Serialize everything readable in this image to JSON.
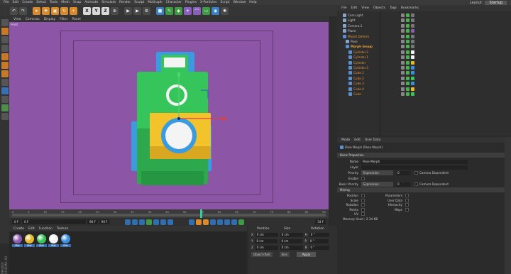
{
  "menu": [
    "File",
    "Edit",
    "Create",
    "Select",
    "Tools",
    "Mesh",
    "Snap",
    "Animate",
    "Simulate",
    "Render",
    "Sculpt",
    "MoGraph",
    "Character",
    "Plugins",
    "X-Particles",
    "Script",
    "Window",
    "Help"
  ],
  "layout": {
    "label": "Layout:",
    "value": "Startup"
  },
  "toolbar": {
    "x": "X",
    "y": "Y",
    "z": "Z"
  },
  "viewport": {
    "menu": [
      "View",
      "Cameras",
      "Display",
      "Filter",
      "Panel"
    ],
    "label": "Front"
  },
  "timeline": {
    "ticks": [
      "0",
      "5",
      "10",
      "15",
      "20",
      "25",
      "30",
      "35",
      "40",
      "45",
      "50",
      "55",
      "60",
      "65",
      "70",
      "75",
      "80",
      "85",
      "90"
    ],
    "frame_start": "0 F",
    "frame_current": "0 F",
    "frame_end": "90 F",
    "frame_total": "90 F",
    "frame_right": "54 F",
    "cursor_frame": 54
  },
  "materials": {
    "menu": [
      "Create",
      "Edit",
      "Function",
      "Texture"
    ],
    "items": [
      {
        "label": "Mat",
        "color": "#8e5bb0"
      },
      {
        "label": "Mat",
        "color": "#e7b92b"
      },
      {
        "label": "Mat",
        "color": "#3cc35a"
      },
      {
        "label": "Mat",
        "color": "#f2f2f2"
      },
      {
        "label": "Mat",
        "color": "#3b8fe0"
      }
    ],
    "watermark": "MAXON CINEMA 4D"
  },
  "coordinates": {
    "headers": [
      "Position",
      "Size",
      "Rotation"
    ],
    "rows": [
      {
        "axis": "X",
        "pos": "0 cm",
        "size": "0 cm",
        "rot_label": "H",
        "rot": "0 °"
      },
      {
        "axis": "Y",
        "pos": "0 cm",
        "size": "0 cm",
        "rot_label": "P",
        "rot": "0 °"
      },
      {
        "axis": "Z",
        "pos": "0 cm",
        "size": "0 cm",
        "rot_label": "B",
        "rot": "0 °"
      }
    ],
    "mode": "Object (Rel)",
    "size_mode": "Size",
    "apply": "Apply"
  },
  "objects": {
    "menu": [
      "File",
      "Edit",
      "View",
      "Objects",
      "Tags",
      "Bookmarks"
    ],
    "items": [
      {
        "name": "Cam Light",
        "style": "normal",
        "tag": "#777"
      },
      {
        "name": "Light",
        "style": "normal",
        "tag": "#777"
      },
      {
        "name": "Camera.1",
        "style": "normal",
        "tag": "#777"
      },
      {
        "name": "Plane",
        "style": "normal",
        "tag": "#8e5bb0"
      },
      {
        "name": "Morph Deform",
        "style": "orange",
        "tag": "#777"
      },
      {
        "name": "Pose",
        "style": "normal",
        "tag": "#777"
      },
      {
        "name": "Morph Group",
        "style": "highlight",
        "tag": "#777"
      },
      {
        "name": "Cylinder.2",
        "style": "orange",
        "tag": "#f2f2f2"
      },
      {
        "name": "Cylinder.1",
        "style": "orange",
        "tag": "#f2f2f2"
      },
      {
        "name": "Cylinder",
        "style": "orange",
        "tag": "#e7b92b"
      },
      {
        "name": "Cylinder.3",
        "style": "orange",
        "tag": "#3b8fe0"
      },
      {
        "name": "Cube.1",
        "style": "orange",
        "tag": "#3b8fe0"
      },
      {
        "name": "Cube.2",
        "style": "orange",
        "tag": "#3cc35a"
      },
      {
        "name": "Cube.3",
        "style": "orange",
        "tag": "#3b8fe0"
      },
      {
        "name": "Cube.4",
        "style": "orange",
        "tag": "#e7b92b"
      },
      {
        "name": "Cube",
        "style": "orange",
        "tag": "#3cc35a"
      }
    ]
  },
  "attributes": {
    "menu": [
      "Mode",
      "Edit",
      "User Data"
    ],
    "title": "Pose Morph [Pose Morph]",
    "section_basic": "Basic Properties",
    "fields": [
      {
        "label": "Name",
        "value": "Pose Morph"
      },
      {
        "label": "Layer",
        "value": ""
      }
    ],
    "priority_label": "Priority",
    "priority_mode": "Expression",
    "priority_value": "0",
    "camera_dependent": "Camera Dependent",
    "enable_label": "Enable",
    "basic_priority_label": "Basic Priority",
    "basic_priority_mode": "Expression",
    "basic_priority_value": "0",
    "mixing_section": "Mixing",
    "mixing_left": [
      "Position",
      "Scale",
      "Rotation",
      "Points",
      "UV"
    ],
    "mixing_right": [
      "Parameters",
      "User Data",
      "Hierarchy",
      "Maps"
    ],
    "memory": "Memory Used : 2.34 KB"
  },
  "colors": {
    "viewport_bg": "#8d55a6",
    "accent_orange": "#d98b2b",
    "accent_blue": "#3b7fc4",
    "timeline_cursor": "#37c9a0"
  }
}
